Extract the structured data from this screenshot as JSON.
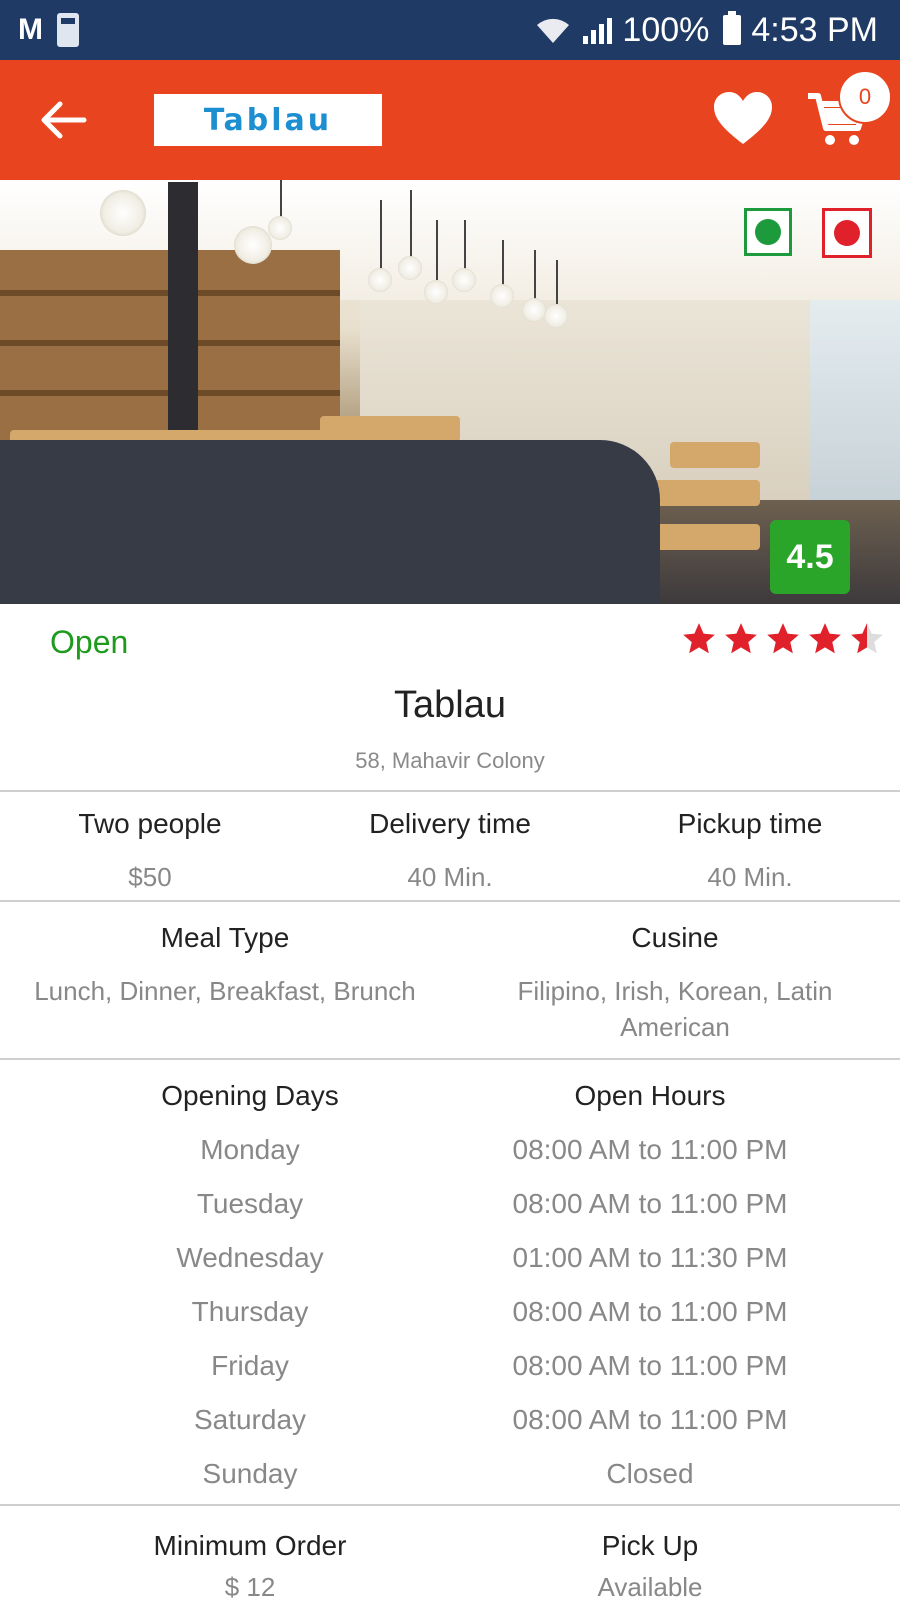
{
  "status_bar": {
    "battery": "100%",
    "time": "4:53 PM"
  },
  "app_bar": {
    "logo_text": "Tablau",
    "cart_count": "0"
  },
  "hero": {
    "rating": "4.5"
  },
  "restaurant": {
    "status": "Open",
    "star_rating": 4.5,
    "name": "Tablau",
    "address": "58, Mahavir Colony"
  },
  "info": {
    "two_people_label": "Two people",
    "two_people_value": "$50",
    "delivery_label": "Delivery time",
    "delivery_value": "40 Min.",
    "pickup_label": "Pickup time",
    "pickup_value": "40 Min."
  },
  "meal": {
    "meal_type_label": "Meal Type",
    "meal_type_value": "Lunch, Dinner, Breakfast, Brunch",
    "cuisine_label": "Cusine",
    "cuisine_value_line1": "Filipino, Irish, Korean, Latin",
    "cuisine_value_line2": "American"
  },
  "schedule": {
    "days_label": "Opening Days",
    "hours_label": "Open Hours",
    "rows": [
      {
        "day": "Monday",
        "hours": "08:00 AM to 11:00 PM"
      },
      {
        "day": "Tuesday",
        "hours": "08:00 AM to 11:00 PM"
      },
      {
        "day": "Wednesday",
        "hours": "01:00 AM to 11:30 PM"
      },
      {
        "day": "Thursday",
        "hours": "08:00 AM to 11:00 PM"
      },
      {
        "day": "Friday",
        "hours": "08:00 AM to 11:00 PM"
      },
      {
        "day": "Saturday",
        "hours": "08:00 AM to 11:00 PM"
      },
      {
        "day": "Sunday",
        "hours": "Closed"
      }
    ]
  },
  "order": {
    "min_order_label": "Minimum Order",
    "min_order_value": "$ 12",
    "pickup_label": "Pick Up",
    "pickup_value": "Available"
  },
  "colors": {
    "app_bar": "#e8441f",
    "status_bar": "#1f3a64",
    "open_green": "#1e9a1e",
    "rating_green": "#2aa52a",
    "star_red": "#e0202a"
  }
}
